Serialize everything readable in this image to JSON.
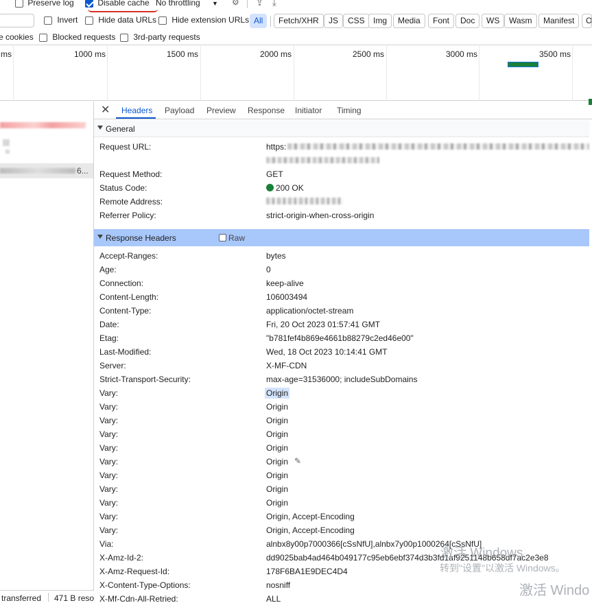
{
  "toolbar": {
    "preserve_log_label": "Preserve log",
    "disable_cache_label": "Disable cache",
    "throttling_label": "No throttling",
    "invert_label": "Invert",
    "hide_data_urls_label": "Hide data URLs",
    "hide_extension_urls_label": "Hide extension URLs",
    "cookies_label": "e cookies",
    "blocked_requests_label": "Blocked requests",
    "third_party_label": "3rd-party requests",
    "filter_chips": [
      "All",
      "Fetch/XHR",
      "JS",
      "CSS",
      "Img",
      "Media",
      "Font",
      "Doc",
      "WS",
      "Wasm",
      "Manifest",
      "O"
    ]
  },
  "timeline": {
    "ticks": [
      "ms",
      "1000 ms",
      "1500 ms",
      "2000 ms",
      "2500 ms",
      "3000 ms",
      "3500 ms"
    ]
  },
  "request_list": {
    "partial_row": "6..."
  },
  "detail": {
    "tabs": [
      "Headers",
      "Payload",
      "Preview",
      "Response",
      "Initiator",
      "Timing"
    ],
    "general_title": "General",
    "general": [
      {
        "name": "Request URL:",
        "value": "https:"
      },
      {
        "name": "Request Method:",
        "value": "GET"
      },
      {
        "name": "Status Code:",
        "value": "200 OK"
      },
      {
        "name": "Remote Address:",
        "value": ""
      },
      {
        "name": "Referrer Policy:",
        "value": "strict-origin-when-cross-origin"
      }
    ],
    "response_title": "Response Headers",
    "raw_label": "Raw",
    "response_headers": [
      {
        "name": "Accept-Ranges:",
        "value": "bytes"
      },
      {
        "name": "Age:",
        "value": "0"
      },
      {
        "name": "Connection:",
        "value": "keep-alive"
      },
      {
        "name": "Content-Length:",
        "value": "106003494"
      },
      {
        "name": "Content-Type:",
        "value": "application/octet-stream"
      },
      {
        "name": "Date:",
        "value": "Fri, 20 Oct 2023 01:57:41 GMT"
      },
      {
        "name": "Etag:",
        "value": "\"b781fef4b869e4661b88279c2ed46e00\""
      },
      {
        "name": "Last-Modified:",
        "value": "Wed, 18 Oct 2023 10:14:41 GMT"
      },
      {
        "name": "Server:",
        "value": "X-MF-CDN"
      },
      {
        "name": "Strict-Transport-Security:",
        "value": "max-age=31536000; includeSubDomains"
      },
      {
        "name": "Vary:",
        "value": "Origin"
      },
      {
        "name": "Vary:",
        "value": "Origin"
      },
      {
        "name": "Vary:",
        "value": "Origin"
      },
      {
        "name": "Vary:",
        "value": "Origin"
      },
      {
        "name": "Vary:",
        "value": "Origin"
      },
      {
        "name": "Vary:",
        "value": "Origin"
      },
      {
        "name": "Vary:",
        "value": "Origin"
      },
      {
        "name": "Vary:",
        "value": "Origin"
      },
      {
        "name": "Vary:",
        "value": "Origin"
      },
      {
        "name": "Vary:",
        "value": "Origin, Accept-Encoding"
      },
      {
        "name": "Vary:",
        "value": "Origin, Accept-Encoding"
      },
      {
        "name": "Via:",
        "value": "alnbx8y00p7000366[cSsNfU],alnbx7y00p1000264[cSsNfU]"
      },
      {
        "name": "X-Amz-Id-2:",
        "value": "dd9025bab4ad464b049177c95eb6ebf374d3b3fd1af9251148b658df7ac2e3e8"
      },
      {
        "name": "X-Amz-Request-Id:",
        "value": "178F6BA1E9DEC4D4"
      },
      {
        "name": "X-Content-Type-Options:",
        "value": "nosniff"
      },
      {
        "name": "X-Mf-Cdn-All-Retried:",
        "value": "ALL"
      }
    ]
  },
  "status_bar": {
    "transferred": "transferred",
    "resources": "471 B reso"
  },
  "watermark": {
    "line1": "激活 Windows",
    "line2": "转到\"设置\"以激活 Windows。",
    "line3": "激活 Windo"
  },
  "colors": {
    "accent": "#0b57d0",
    "section_highlight": "#a8c7fa",
    "status_ok": "#188038"
  }
}
